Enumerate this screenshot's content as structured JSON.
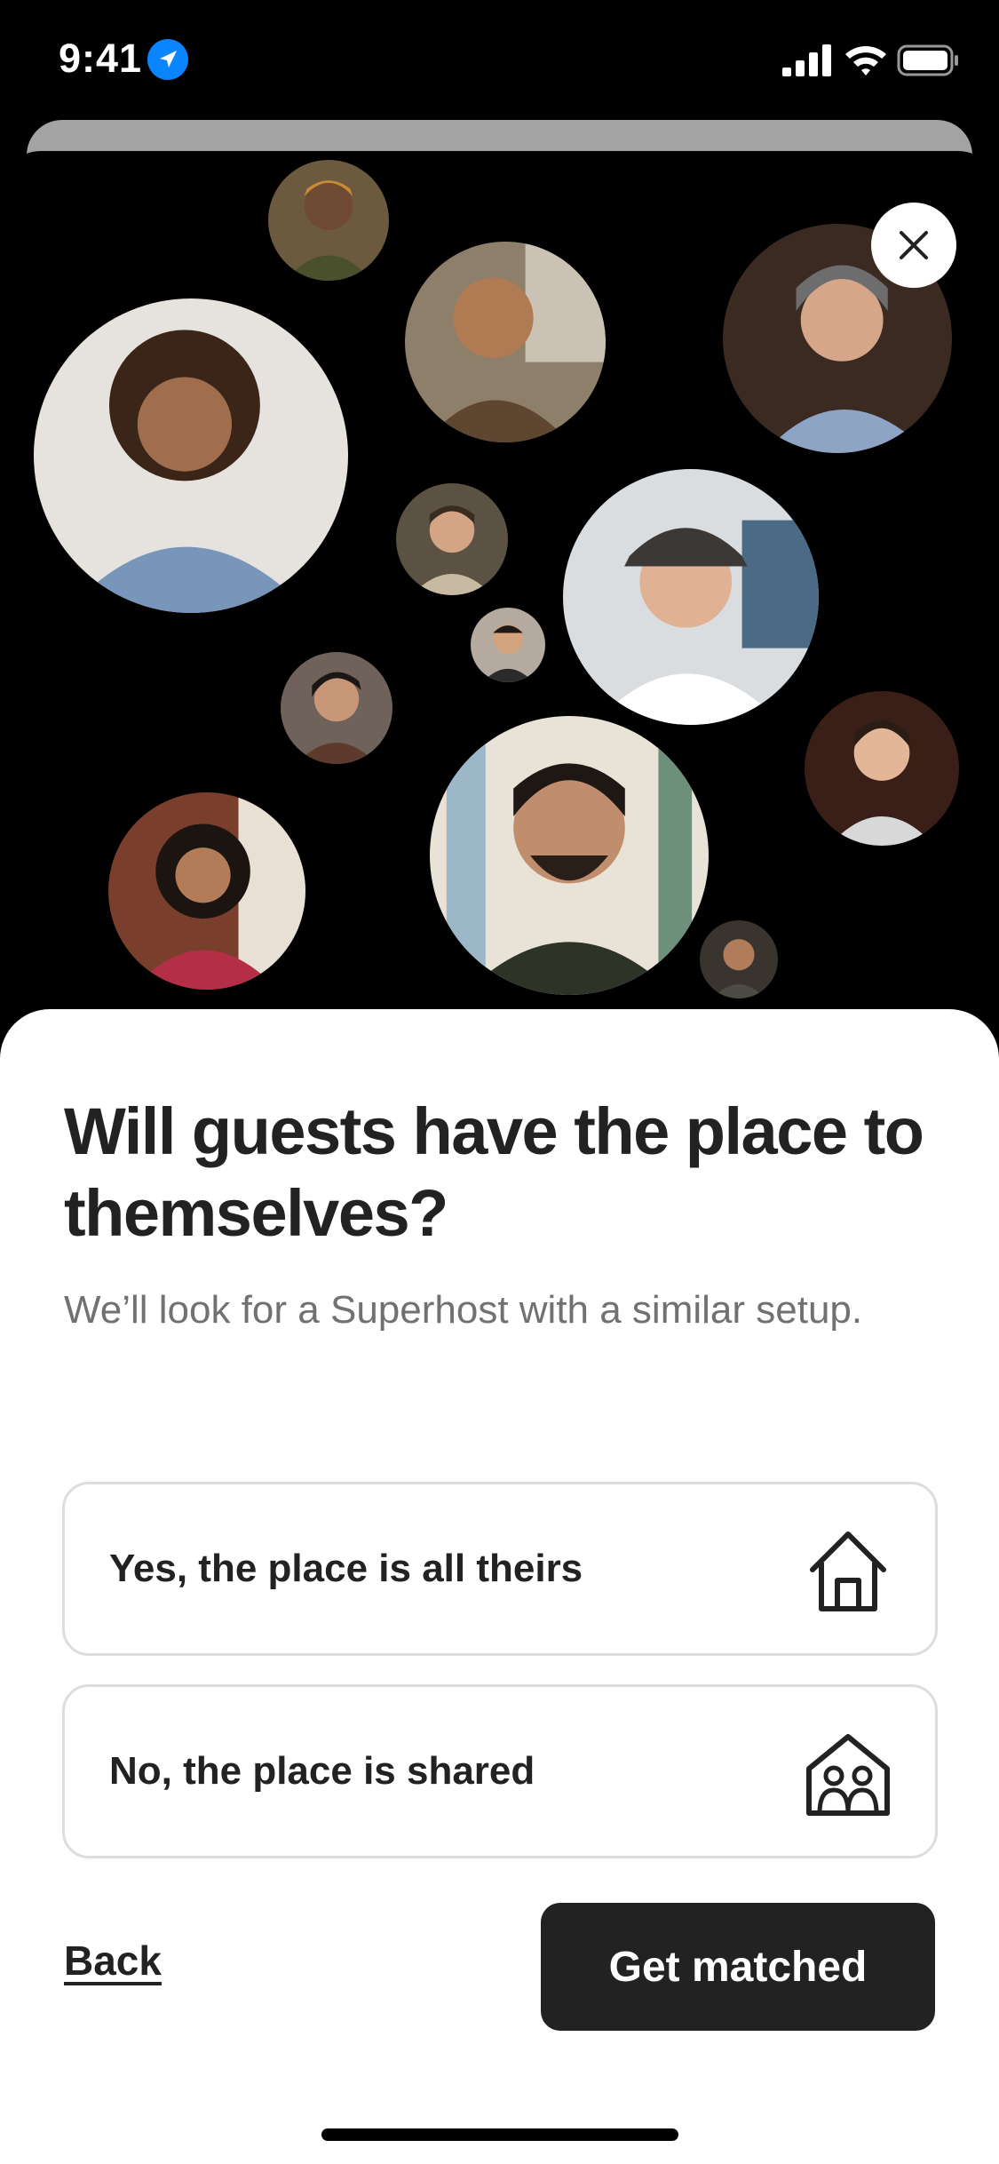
{
  "status_bar": {
    "time": "9:41"
  },
  "modal": {
    "title": "Will guests have the place to themselves?",
    "subtitle": "We’ll look for a Superhost with a similar setup.",
    "options": [
      {
        "label": "Yes, the place is all theirs",
        "icon": "house-icon"
      },
      {
        "label": "No, the place is shared",
        "icon": "shared-house-icon"
      }
    ],
    "back_label": "Back",
    "cta_label": "Get matched"
  },
  "colors": {
    "cta_bg": "#222222",
    "text_primary": "#222222",
    "text_secondary": "#717171",
    "border": "#dddddd",
    "location_blue": "#0a84ff"
  }
}
